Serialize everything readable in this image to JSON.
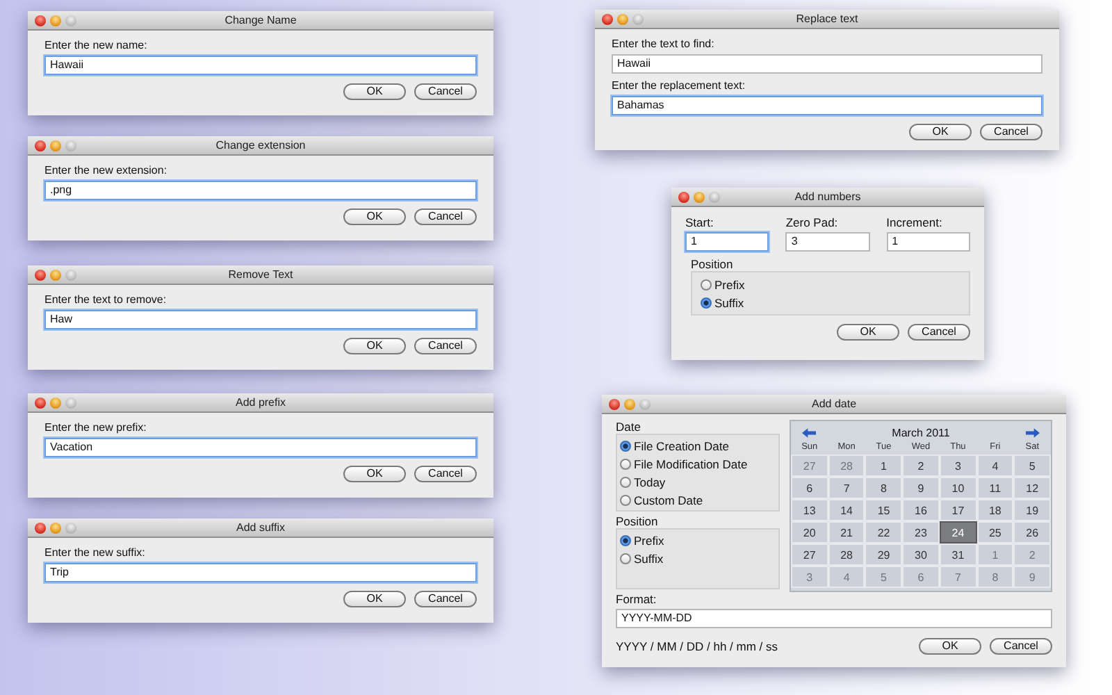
{
  "windows": [
    {
      "kind": "prompt",
      "title": "Change Name",
      "fields": [
        {
          "label": "Enter the new name:",
          "value": "Hawaii",
          "focused": true
        }
      ],
      "buttons": [
        "OK",
        "Cancel"
      ]
    },
    {
      "kind": "prompt",
      "title": "Change extension",
      "fields": [
        {
          "label": "Enter the new extension:",
          "value": ".png",
          "focused": true
        }
      ],
      "buttons": [
        "OK",
        "Cancel"
      ]
    },
    {
      "kind": "prompt",
      "title": "Remove Text",
      "fields": [
        {
          "label": "Enter the text to remove:",
          "value": "Haw",
          "focused": true
        }
      ],
      "buttons": [
        "OK",
        "Cancel"
      ]
    },
    {
      "kind": "prompt",
      "title": "Add prefix",
      "fields": [
        {
          "label": "Enter the new prefix:",
          "value": "Vacation",
          "focused": true
        }
      ],
      "buttons": [
        "OK",
        "Cancel"
      ]
    },
    {
      "kind": "prompt",
      "title": "Add suffix",
      "fields": [
        {
          "label": "Enter the new suffix:",
          "value": "Trip",
          "focused": true
        }
      ],
      "buttons": [
        "OK",
        "Cancel"
      ]
    },
    {
      "kind": "prompt",
      "title": "Replace text",
      "fields": [
        {
          "label": "Enter the text to find:",
          "value": "Hawaii",
          "focused": false
        },
        {
          "label": "Enter the replacement text:",
          "value": "Bahamas",
          "focused": true
        }
      ],
      "buttons": [
        "OK",
        "Cancel"
      ]
    },
    {
      "kind": "numbers",
      "title": "Add numbers",
      "fields": [
        {
          "label": "Start:",
          "value": "1",
          "focused": true
        },
        {
          "label": "Zero Pad:",
          "value": "3",
          "focused": false
        },
        {
          "label": "Increment:",
          "value": "1",
          "focused": false
        }
      ],
      "groups": [
        {
          "label": "Position",
          "options": [
            {
              "label": "Prefix",
              "selected": false
            },
            {
              "label": "Suffix",
              "selected": true
            }
          ]
        }
      ],
      "buttons": [
        "OK",
        "Cancel"
      ]
    },
    {
      "kind": "date",
      "title": "Add date",
      "groups": [
        {
          "label": "Date",
          "options": [
            {
              "label": "File Creation Date",
              "selected": true
            },
            {
              "label": "File Modification Date",
              "selected": false
            },
            {
              "label": "Today",
              "selected": false
            },
            {
              "label": "Custom Date",
              "selected": false
            }
          ]
        },
        {
          "label": "Position",
          "options": [
            {
              "label": "Prefix",
              "selected": true
            },
            {
              "label": "Suffix",
              "selected": false
            }
          ]
        }
      ],
      "calendar": {
        "month": "March 2011",
        "weekdays": [
          "Sun",
          "Mon",
          "Tue",
          "Wed",
          "Thu",
          "Fri",
          "Sat"
        ],
        "days": [
          {
            "label": "27",
            "in_month": false,
            "selected": false
          },
          {
            "label": "28",
            "in_month": false,
            "selected": false
          },
          {
            "label": "1",
            "in_month": true,
            "selected": false
          },
          {
            "label": "2",
            "in_month": true,
            "selected": false
          },
          {
            "label": "3",
            "in_month": true,
            "selected": false
          },
          {
            "label": "4",
            "in_month": true,
            "selected": false
          },
          {
            "label": "5",
            "in_month": true,
            "selected": false
          },
          {
            "label": "6",
            "in_month": true,
            "selected": false
          },
          {
            "label": "7",
            "in_month": true,
            "selected": false
          },
          {
            "label": "8",
            "in_month": true,
            "selected": false
          },
          {
            "label": "9",
            "in_month": true,
            "selected": false
          },
          {
            "label": "10",
            "in_month": true,
            "selected": false
          },
          {
            "label": "11",
            "in_month": true,
            "selected": false
          },
          {
            "label": "12",
            "in_month": true,
            "selected": false
          },
          {
            "label": "13",
            "in_month": true,
            "selected": false
          },
          {
            "label": "14",
            "in_month": true,
            "selected": false
          },
          {
            "label": "15",
            "in_month": true,
            "selected": false
          },
          {
            "label": "16",
            "in_month": true,
            "selected": false
          },
          {
            "label": "17",
            "in_month": true,
            "selected": false
          },
          {
            "label": "18",
            "in_month": true,
            "selected": false
          },
          {
            "label": "19",
            "in_month": true,
            "selected": false
          },
          {
            "label": "20",
            "in_month": true,
            "selected": false
          },
          {
            "label": "21",
            "in_month": true,
            "selected": false
          },
          {
            "label": "22",
            "in_month": true,
            "selected": false
          },
          {
            "label": "23",
            "in_month": true,
            "selected": false
          },
          {
            "label": "24",
            "in_month": true,
            "selected": true
          },
          {
            "label": "25",
            "in_month": true,
            "selected": false
          },
          {
            "label": "26",
            "in_month": true,
            "selected": false
          },
          {
            "label": "27",
            "in_month": true,
            "selected": false
          },
          {
            "label": "28",
            "in_month": true,
            "selected": false
          },
          {
            "label": "29",
            "in_month": true,
            "selected": false
          },
          {
            "label": "30",
            "in_month": true,
            "selected": false
          },
          {
            "label": "31",
            "in_month": true,
            "selected": false
          },
          {
            "label": "1",
            "in_month": false,
            "selected": false
          },
          {
            "label": "2",
            "in_month": false,
            "selected": false
          },
          {
            "label": "3",
            "in_month": false,
            "selected": false
          },
          {
            "label": "4",
            "in_month": false,
            "selected": false
          },
          {
            "label": "5",
            "in_month": false,
            "selected": false
          },
          {
            "label": "6",
            "in_month": false,
            "selected": false
          },
          {
            "label": "7",
            "in_month": false,
            "selected": false
          },
          {
            "label": "8",
            "in_month": false,
            "selected": false
          },
          {
            "label": "9",
            "in_month": false,
            "selected": false
          }
        ]
      },
      "format": {
        "label": "Format:",
        "value": "YYYY-MM-DD",
        "focused": false
      },
      "hint": "YYYY / MM / DD / hh / mm / ss",
      "buttons": [
        "OK",
        "Cancel"
      ]
    }
  ]
}
